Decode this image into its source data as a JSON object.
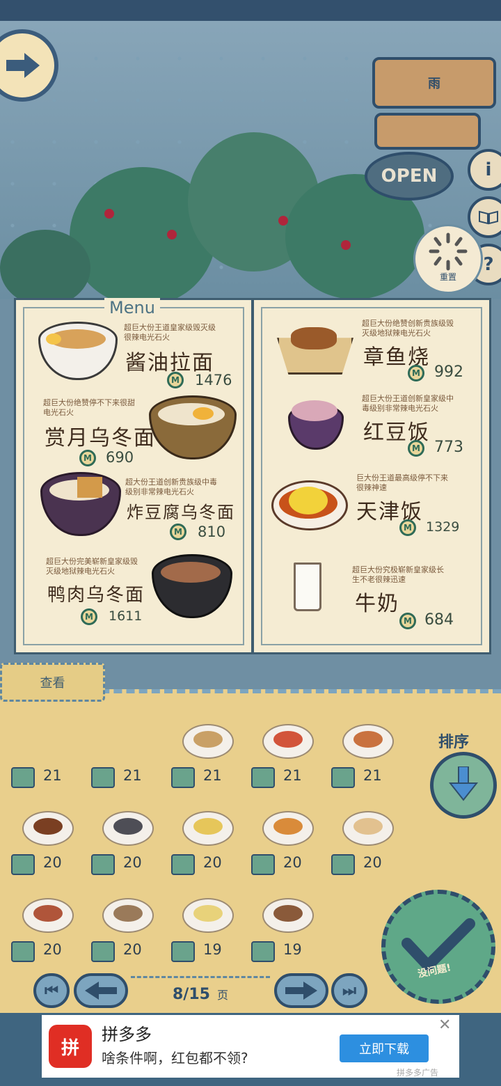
{
  "sign": {
    "top_text": "雨",
    "open_text": "OPEN",
    "info": "i",
    "help": "?"
  },
  "reset_label": "重置",
  "menu": {
    "title": "Menu",
    "left": [
      {
        "desc": "超巨大份王道皇家级毁灭级\n很辣电光石火",
        "name": "酱油拉面",
        "price": "1476"
      },
      {
        "desc": "超巨大份绝赞停不下来很甜\n电光石火",
        "name": "赏月乌冬面",
        "price": "690"
      },
      {
        "desc": "超大份王道创新贵族级中毒\n级别非常辣电光石火",
        "name": "炸豆腐乌冬面",
        "price": "810"
      },
      {
        "desc": "超巨大份完美崭新皇家级毁\n灭级地狱辣电光石火",
        "name": "鸭肉乌冬面",
        "price": "1611"
      }
    ],
    "right": [
      {
        "desc": "超巨大份绝赞创新贵族级毁\n灭级地狱辣电光石火",
        "name": "章鱼烧",
        "price": "992"
      },
      {
        "desc": "超巨大份王道创新皇家级中\n毒级别非常辣电光石火",
        "name": "红豆饭",
        "price": "773"
      },
      {
        "desc": "巨大份王道最高级停不下来\n很辣神速",
        "name": "天津饭",
        "price": "1329"
      },
      {
        "desc": "超巨大份究极崭新皇家级长\n生不老很辣迅速",
        "name": "牛奶",
        "price": "684"
      }
    ]
  },
  "inventory": {
    "tab_label": "查看",
    "sort_label": "排序",
    "confirm_label": "没问题!",
    "items": [
      {
        "count": "21",
        "color": "#e0b27a",
        "empty": true
      },
      {
        "count": "21",
        "color": "#e0b27a",
        "empty": true
      },
      {
        "count": "21",
        "color": "#c9a066",
        "empty": false
      },
      {
        "count": "21",
        "color": "#d2543a",
        "empty": false
      },
      {
        "count": "21",
        "color": "#c9723f",
        "empty": false
      },
      {
        "count": "20",
        "color": "#7a3f22",
        "empty": false
      },
      {
        "count": "20",
        "color": "#4e4e56",
        "empty": false
      },
      {
        "count": "20",
        "color": "#e6c65a",
        "empty": false
      },
      {
        "count": "20",
        "color": "#d98b3a",
        "empty": false
      },
      {
        "count": "20",
        "color": "#e2c18f",
        "empty": false
      },
      {
        "count": "20",
        "color": "#b0553a",
        "empty": false
      },
      {
        "count": "20",
        "color": "#9a7a5a",
        "empty": false
      },
      {
        "count": "19",
        "color": "#e8d27a",
        "empty": false
      },
      {
        "count": "19",
        "color": "#8a5a3a",
        "empty": false
      }
    ],
    "page_current": "8/15",
    "page_unit": "页"
  },
  "ad": {
    "logo": "拼",
    "title": "拼多多",
    "subtitle": "啥条件啊，红包都不领?",
    "button": "立即下载",
    "close": "✕",
    "tag": "拼多多广告"
  }
}
